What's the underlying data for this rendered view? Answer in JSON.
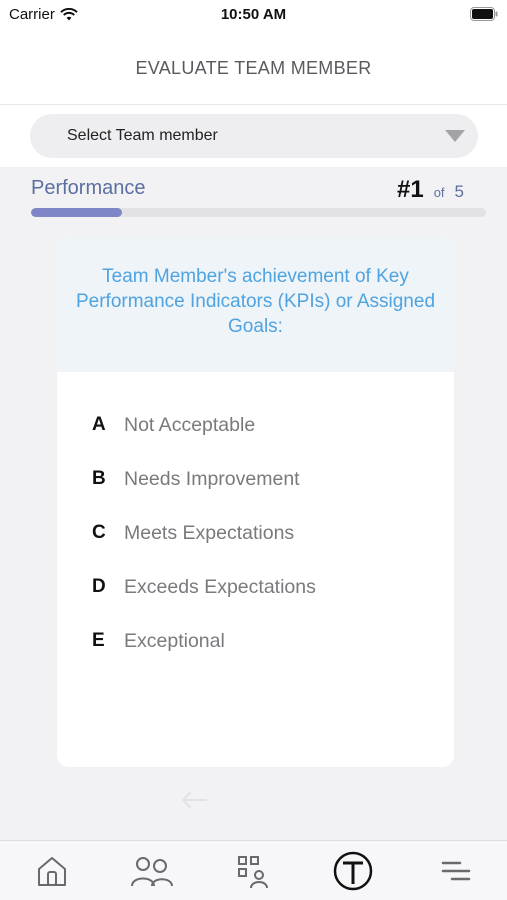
{
  "status_bar": {
    "carrier": "Carrier",
    "time": "10:50 AM"
  },
  "header": {
    "title": "EVALUATE TEAM MEMBER"
  },
  "select": {
    "label": "Select Team member"
  },
  "section": {
    "label": "Performance"
  },
  "counter": {
    "current": "#1",
    "of": "of",
    "total": "5"
  },
  "progress": {
    "fraction": 0.2
  },
  "question": {
    "text": "Team Member's achievement of Key Performance Indicators (KPIs) or Assigned Goals:"
  },
  "options": [
    {
      "letter": "A",
      "text": "Not Acceptable"
    },
    {
      "letter": "B",
      "text": "Needs Improvement"
    },
    {
      "letter": "C",
      "text": "Meets Expectations"
    },
    {
      "letter": "D",
      "text": "Exceeds Expectations"
    },
    {
      "letter": "E",
      "text": "Exceptional"
    }
  ],
  "tabbar": {
    "items": [
      {
        "icon": "home-icon"
      },
      {
        "icon": "team-icon"
      },
      {
        "icon": "org-chart-icon"
      },
      {
        "icon": "evaluate-icon"
      },
      {
        "icon": "menu-icon"
      }
    ]
  },
  "colors": {
    "accent": "#4fa3e0",
    "progress": "#7f86c7",
    "section_label": "#5b6fa0"
  }
}
